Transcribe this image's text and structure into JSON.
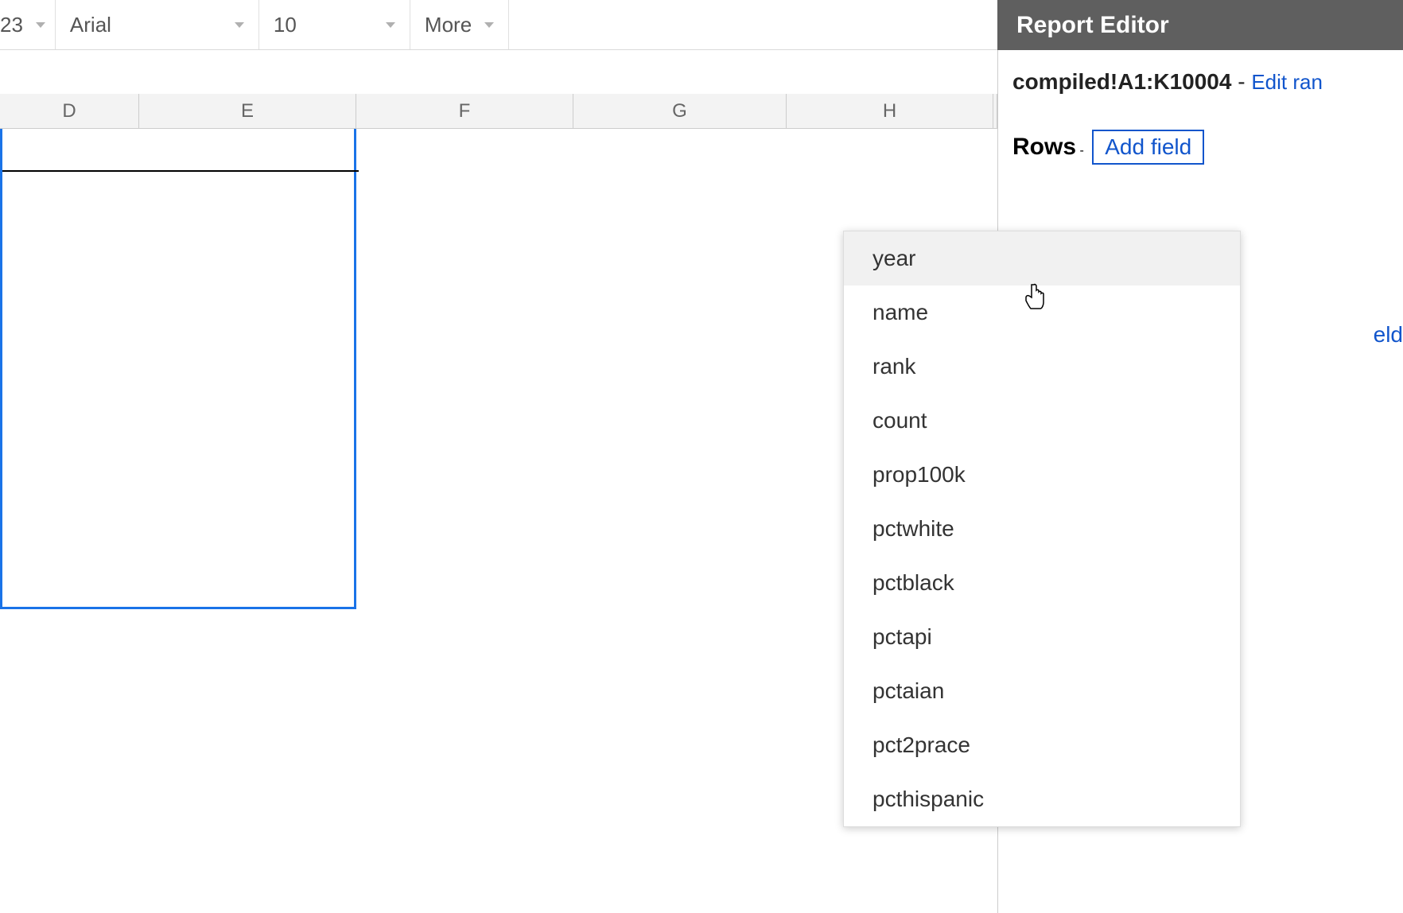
{
  "toolbar": {
    "format_number": "23",
    "font": "Arial",
    "font_size": "10",
    "more": "More"
  },
  "report_editor": {
    "title": "Report Editor",
    "range": "compiled!A1:K10004",
    "range_separator": " - ",
    "edit_range": "Edit ran",
    "rows_label": "Rows",
    "rows_separator": " - ",
    "add_field": "Add field",
    "columns_partial": "eld"
  },
  "columns": {
    "d": "D",
    "e": "E",
    "f": "F",
    "g": "G",
    "h": "H"
  },
  "field_options": [
    "year",
    "name",
    "rank",
    "count",
    "prop100k",
    "pctwhite",
    "pctblack",
    "pctapi",
    "pctaian",
    "pct2prace",
    "pcthispanic"
  ]
}
